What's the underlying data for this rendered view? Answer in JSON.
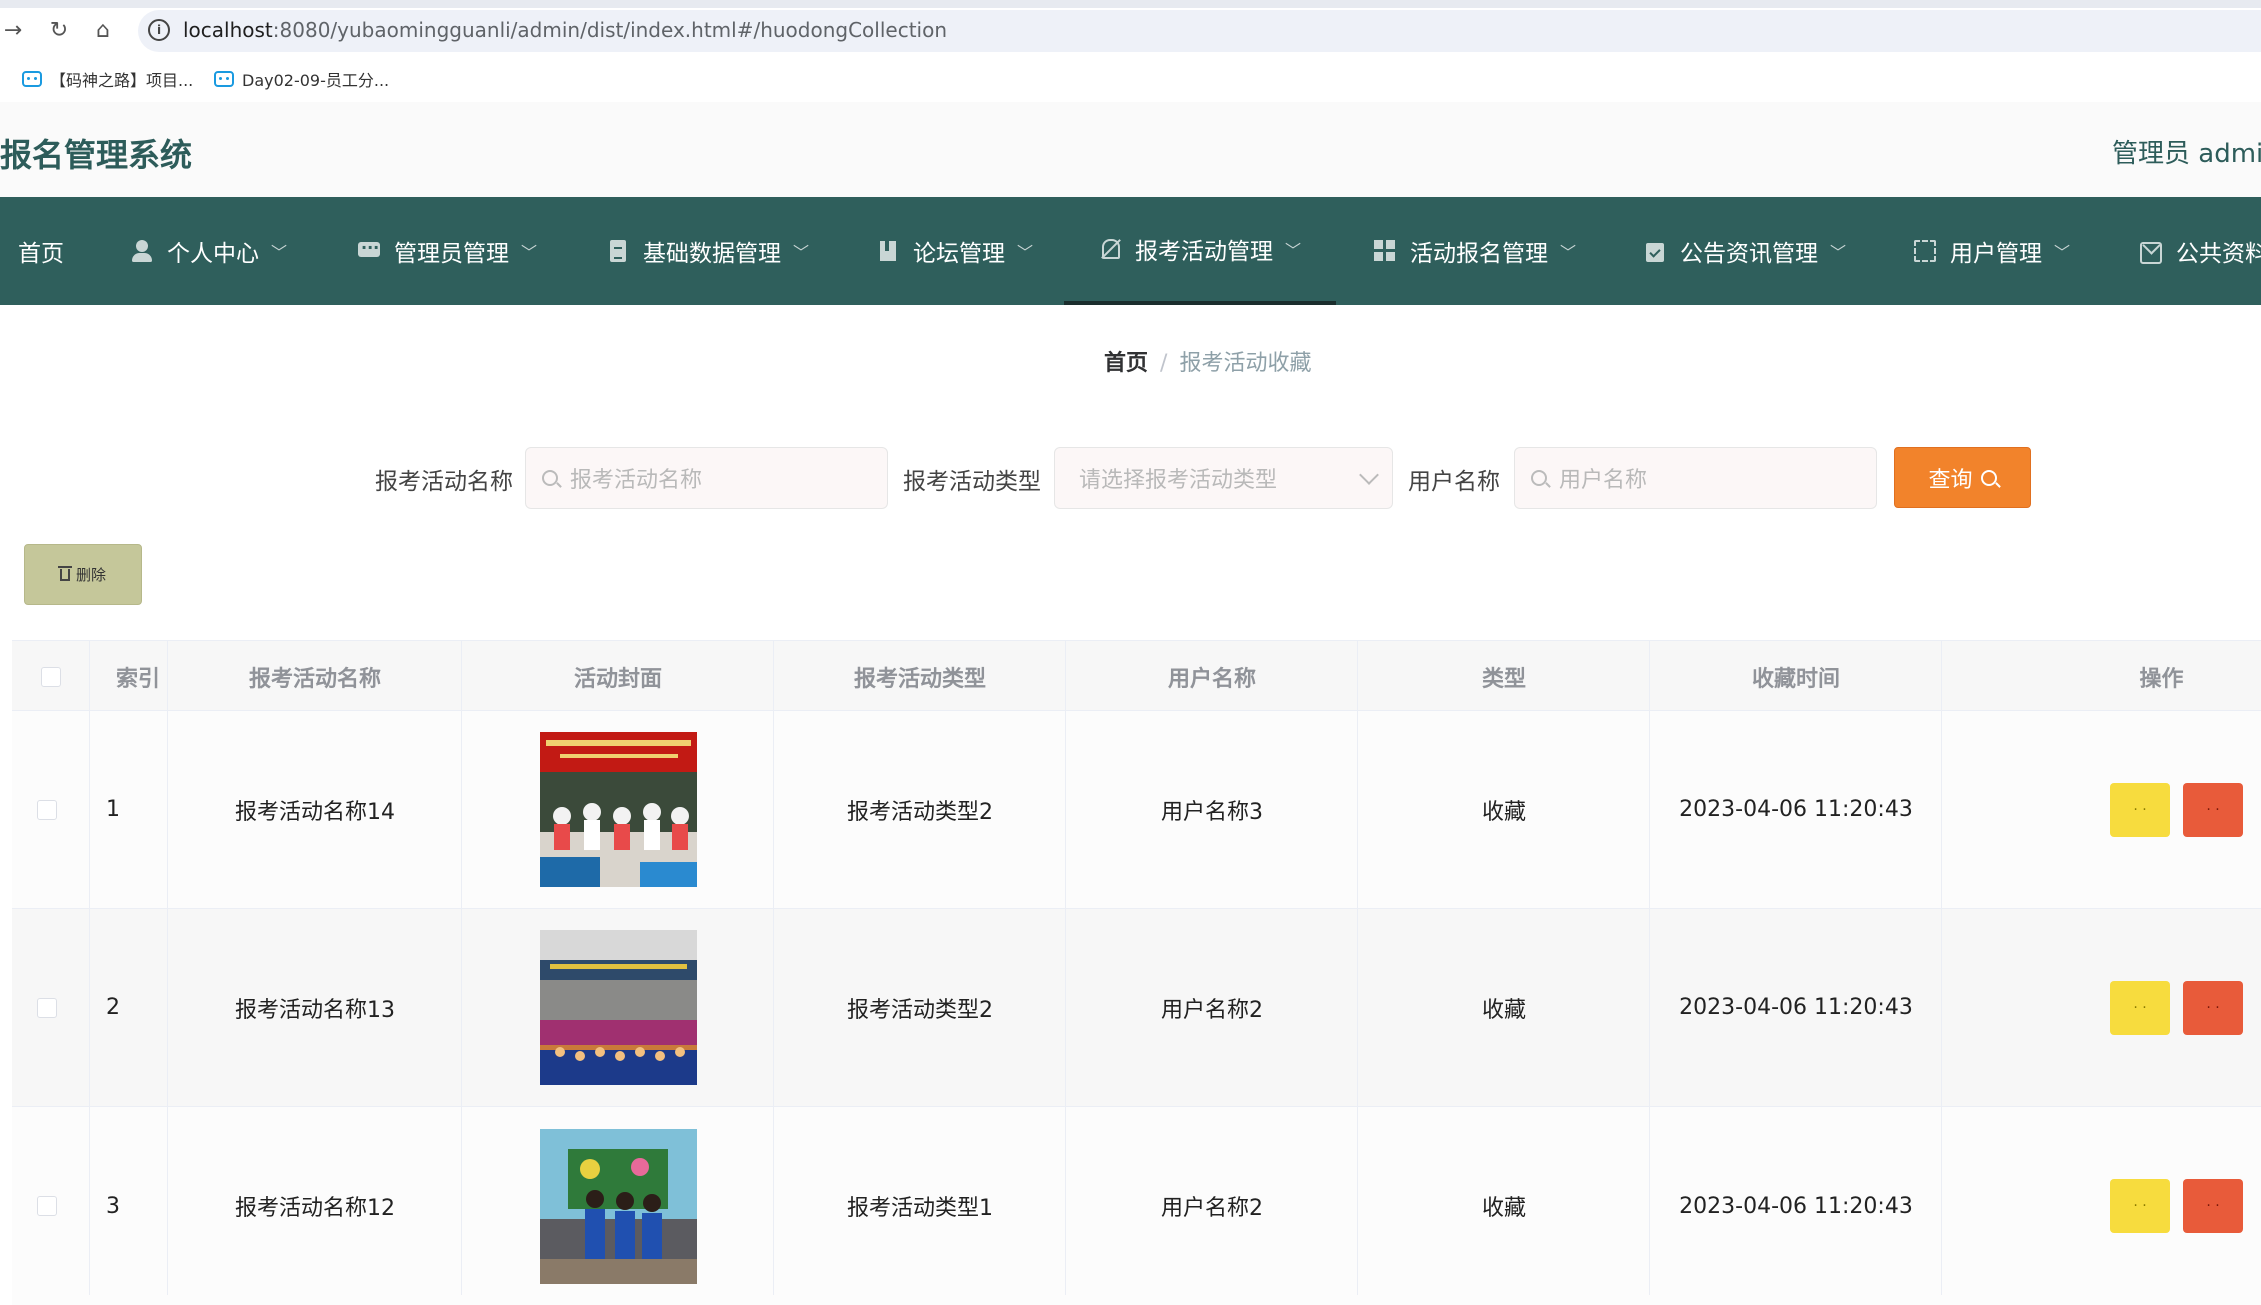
{
  "browser": {
    "url_host": "localhost",
    "url_rest": ":8080/yubaomingguanli/admin/dist/index.html#/huodongCollection",
    "bookmarks": [
      "【码神之路】项目...",
      "Day02-09-员工分..."
    ]
  },
  "header": {
    "app_title": "预报名管理系统",
    "admin_label": "管理员 admin"
  },
  "nav": {
    "items": [
      {
        "label": "首页",
        "icon": "home-icon"
      },
      {
        "label": "个人中心",
        "icon": "user-icon"
      },
      {
        "label": "管理员管理",
        "icon": "chat-icon"
      },
      {
        "label": "基础数据管理",
        "icon": "document-icon"
      },
      {
        "label": "论坛管理",
        "icon": "book-icon"
      },
      {
        "label": "报考活动管理",
        "icon": "bell-off-icon"
      },
      {
        "label": "活动报名管理",
        "icon": "grid-icon"
      },
      {
        "label": "公告资讯管理",
        "icon": "clipboard-icon"
      },
      {
        "label": "用户管理",
        "icon": "fullscreen-icon"
      },
      {
        "label": "公共资料",
        "icon": "mail-icon"
      }
    ],
    "active": "报考活动管理"
  },
  "breadcrumb": {
    "home": "首页",
    "separator": "/",
    "current": "报考活动收藏"
  },
  "search": {
    "activity_name_label": "报考活动名称",
    "activity_name_placeholder": "报考活动名称",
    "activity_type_label": "报考活动类型",
    "activity_type_placeholder": "请选择报考活动类型",
    "username_label": "用户名称",
    "username_placeholder": "用户名称",
    "query_button": "查询"
  },
  "toolbar": {
    "delete_button": "删除"
  },
  "table": {
    "columns": [
      "索引",
      "报考活动名称",
      "活动封面",
      "报考活动类型",
      "用户名称",
      "类型",
      "收藏时间",
      "操作"
    ],
    "rows": [
      {
        "index": "1",
        "name": "报考活动名称14",
        "activity_type": "报考活动类型2",
        "user": "用户名称3",
        "kind": "收藏",
        "time": "2023-04-06 11:20:43"
      },
      {
        "index": "2",
        "name": "报考活动名称13",
        "activity_type": "报考活动类型2",
        "user": "用户名称2",
        "kind": "收藏",
        "time": "2023-04-06 11:20:43"
      },
      {
        "index": "3",
        "name": "报考活动名称12",
        "activity_type": "报考活动类型1",
        "user": "用户名称2",
        "kind": "收藏",
        "time": "2023-04-06 11:20:43"
      }
    ],
    "edit_button": "· ·",
    "delete_button": "· ·"
  },
  "colors": {
    "nav_bg": "#2f5f5c",
    "query_btn": "#f2832b",
    "delete_btn": "#c5c79a",
    "edit_action": "#f7dc3e",
    "delete_action": "#e85b3a"
  }
}
